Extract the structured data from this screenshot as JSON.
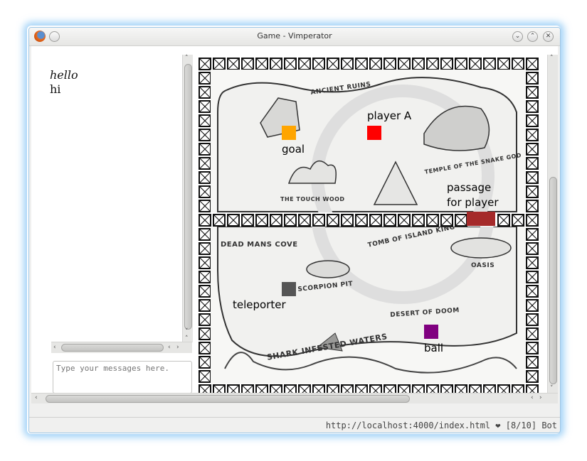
{
  "window": {
    "title": "Game - Vimperator"
  },
  "chat": {
    "messages": [
      {
        "text": "hello",
        "style": "italic"
      },
      {
        "text": "hi",
        "style": "normal"
      }
    ],
    "input_placeholder": "Type your messages here."
  },
  "map_labels": [
    "ANCIENT RUINS",
    "TEMPLE OF THE SNAKE GOD",
    "THE TOUCH WOOD",
    "DEAD MANS COVE",
    "TOMB OF ISLAND KING",
    "OASIS",
    "SCORPION PIT",
    "DESERT OF DOOM",
    "SHARK INFESTED WATERS"
  ],
  "objects": {
    "goal": {
      "label": "goal",
      "color": "#ffa500"
    },
    "player": {
      "label": "player A",
      "color": "#ff0000"
    },
    "passage": {
      "label_line1": "passage",
      "label_line2": "for player",
      "color": "#a52a2a"
    },
    "teleporter": {
      "label": "teleporter",
      "color": "#555555"
    },
    "ball": {
      "label": "ball",
      "color": "#800080"
    }
  },
  "status": {
    "url": "http://localhost:4000/index.html",
    "heart": "❤",
    "position": "[8/10]",
    "scroll": "Bot"
  },
  "colors": {
    "wall": "#111111",
    "window_glow": "#5aaff0"
  }
}
